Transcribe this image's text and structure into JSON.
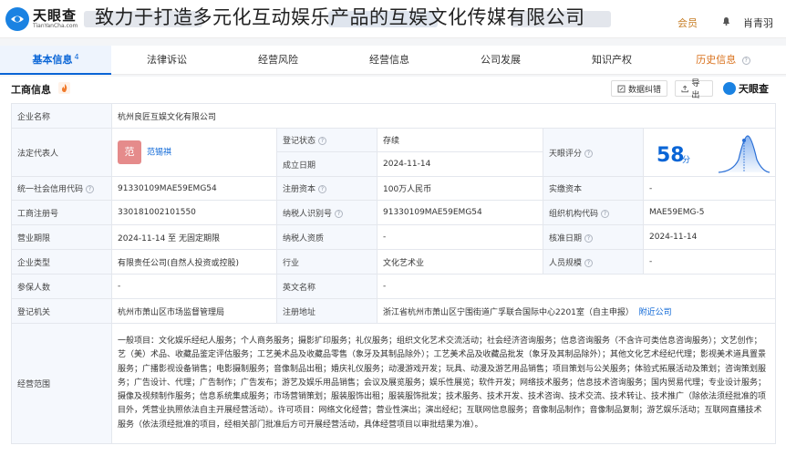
{
  "overlay_title": "致力于打造多元化互动娱乐产品的互娱文化传媒有限公司",
  "logo": {
    "name": "天眼查",
    "domain": "TianYanCha.com"
  },
  "header": {
    "vip_label": "会员",
    "user_name": "肖青羽"
  },
  "tabs": [
    {
      "label": "基本信息",
      "count": "4"
    },
    {
      "label": "法律诉讼"
    },
    {
      "label": "经营风险"
    },
    {
      "label": "经营信息"
    },
    {
      "label": "公司发展"
    },
    {
      "label": "知识产权"
    },
    {
      "label": "历史信息"
    }
  ],
  "section": {
    "title": "工商信息",
    "cut_label": "数据纠错",
    "export_label": "导出",
    "brand": "天眼查"
  },
  "fields": {
    "company_name_label": "企业名称",
    "company_name": "杭州良匠互娱文化有限公司",
    "legal_rep_label": "法定代表人",
    "legal_rep_avatar": "范",
    "legal_rep": "范锡祺",
    "reg_status_label": "登记状态",
    "reg_status": "存续",
    "established_label": "成立日期",
    "established": "2024-11-14",
    "score_label": "天眼评分",
    "score": "58",
    "score_unit": "分",
    "credit_code_label": "统一社会信用代码",
    "credit_code": "91330109MAE59EMG54",
    "reg_capital_label": "注册资本",
    "reg_capital": "100万人民币",
    "paid_capital_label": "实缴资本",
    "paid_capital": "-",
    "reg_no_label": "工商注册号",
    "reg_no": "330181002101550",
    "taxpayer_id_label": "纳税人识别号",
    "taxpayer_id": "91330109MAE59EMG54",
    "org_code_label": "组织机构代码",
    "org_code": "MAE59EMG-5",
    "term_label": "营业期限",
    "term": "2024-11-14 至 无固定期限",
    "taxpayer_qual_label": "纳税人资质",
    "taxpayer_qual": "-",
    "approval_date_label": "核准日期",
    "approval_date": "2024-11-14",
    "company_type_label": "企业类型",
    "company_type": "有限责任公司(自然人投资或控股)",
    "industry_label": "行业",
    "industry": "文化艺术业",
    "staff_size_label": "人员规模",
    "staff_size": "-",
    "insured_label": "参保人数",
    "insured": "-",
    "english_name_label": "英文名称",
    "english_name": "-",
    "authority_label": "登记机关",
    "authority": "杭州市萧山区市场监督管理局",
    "address_label": "注册地址",
    "address": "浙江省杭州市萧山区宁围街道广孚联合国际中心2201室（自主申报）",
    "nearby_label": "附近公司",
    "scope_label": "经营范围",
    "scope": "一般项目：文化娱乐经纪人服务；个人商务服务；摄影扩印服务；礼仪服务；组织文化艺术交流活动；社会经济咨询服务；信息咨询服务（不含许可类信息咨询服务）；文艺创作；艺（美）术品、收藏品鉴定评估服务；工艺美术品及收藏品零售（象牙及其制品除外）；工艺美术品及收藏品批发（象牙及其制品除外）；其他文化艺术经纪代理；影视美术道具置景服务；广播影视设备销售；电影摄制服务；音像制品出租；婚庆礼仪服务；动漫游戏开发；玩具、动漫及游艺用品销售；项目策划与公关服务；体验式拓展活动及策划；咨询策划服务；广告设计、代理；广告制作；广告发布；游艺及娱乐用品销售；会议及展览服务；娱乐性展览；软件开发；网络技术服务；信息技术咨询服务；国内贸易代理；专业设计服务；摄像及视频制作服务；信息系统集成服务；市场营销策划；服装服饰出租；服装服饰批发；技术服务、技术开发、技术咨询、技术交流、技术转让、技术推广（除依法须经批准的项目外，凭营业执照依法自主开展经营活动）。许可项目：网络文化经营；营业性演出；演出经纪；互联网信息服务；音像制品制作；音像制品复制；游艺娱乐活动；互联网直播技术服务（依法须经批准的项目，经相关部门批准后方可开展经营活动，具体经营项目以审批结果为准）。"
  }
}
